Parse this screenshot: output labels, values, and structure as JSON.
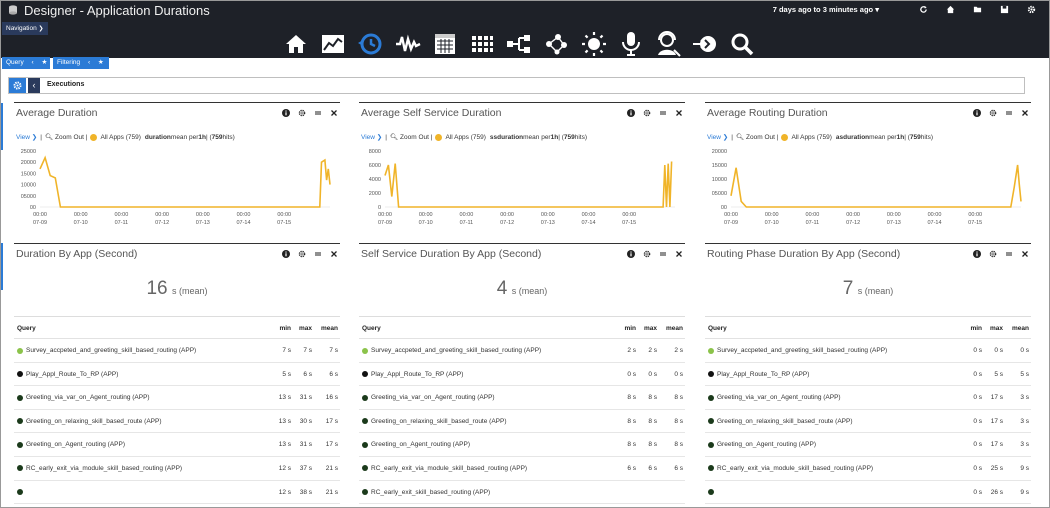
{
  "header": {
    "title": "Designer - Application Durations",
    "time_range": "7 days ago to 3 minutes ago",
    "nav_label": "Navigation",
    "tools": [
      "refresh-icon",
      "home-icon",
      "folder-icon",
      "save-icon",
      "settings-icon"
    ],
    "main_icons": [
      "home-icon",
      "line-chart-icon",
      "history-clock-icon",
      "waveform-icon",
      "calendar-grid-icon",
      "apps-grid-icon",
      "flow-diagram-icon",
      "network-icon",
      "sun-icon",
      "microphone-icon",
      "agent-icon",
      "exit-icon",
      "search-icon"
    ]
  },
  "filters": {
    "query_label": "Query",
    "filtering_label": "Filtering"
  },
  "executions": {
    "label": "Executions"
  },
  "colors": {
    "accent": "#2b7bd6",
    "series": "#f0b429",
    "topbar": "#1e2128"
  },
  "charts": [
    {
      "title": "Average Duration",
      "view_label": "View",
      "zoom_label": "Zoom Out |",
      "series_label": "All Apps (759)",
      "metric": "duration",
      "agg_text": " mean per ",
      "interval": "1h",
      "hits_prefix": " | (",
      "hits": "759",
      "hits_suffix": " hits)",
      "chart_data": {
        "type": "line",
        "series": [
          {
            "name": "All Apps (759)",
            "x": [
              "07-09 00:00",
              "07-09 03:00",
              "07-09 06:00",
              "07-09 09:00",
              "07-09 12:00",
              "07-15 21:00",
              "07-15 22:00",
              "07-16 00:00",
              "07-16 01:00",
              "07-16 02:00",
              "07-16 03:00"
            ],
            "values": [
              17000,
              22000,
              14000,
              13000,
              0,
              0,
              20000,
              21000,
              12000,
              17000,
              10000
            ]
          }
        ],
        "ylim": [
          0,
          25000
        ],
        "yticks": [
          "25000",
          "20000",
          "15000",
          "10000",
          "05000",
          "00"
        ],
        "xticks": [
          {
            "t": "00:00",
            "d": "07-09"
          },
          {
            "t": "00:00",
            "d": "07-10"
          },
          {
            "t": "00:00",
            "d": "07-11"
          },
          {
            "t": "00:00",
            "d": "07-12"
          },
          {
            "t": "00:00",
            "d": "07-13"
          },
          {
            "t": "00:00",
            "d": "07-14"
          },
          {
            "t": "00:00",
            "d": "07-15"
          }
        ],
        "xlabel": "",
        "ylabel": ""
      }
    },
    {
      "title": "Average Self Service Duration",
      "view_label": "View",
      "zoom_label": "Zoom Out |",
      "series_label": "All Apps (759)",
      "metric": "ssduration",
      "agg_text": " mean per ",
      "interval": "1h",
      "hits_prefix": " | (",
      "hits": "759",
      "hits_suffix": " hits)",
      "chart_data": {
        "type": "line",
        "series": [
          {
            "name": "All Apps (759)",
            "x": [
              "07-09 00:00",
              "07-09 02:00",
              "07-09 04:00",
              "07-09 06:00",
              "07-09 08:00",
              "07-15 20:00",
              "07-15 21:00",
              "07-15 22:00",
              "07-15 23:00",
              "07-16 00:00",
              "07-16 01:00"
            ],
            "values": [
              4500,
              6000,
              1500,
              6200,
              0,
              0,
              6000,
              0,
              6200,
              0,
              6500
            ]
          }
        ],
        "ylim": [
          0,
          8000
        ],
        "yticks": [
          "8000",
          "6000",
          "4000",
          "2000",
          "0"
        ],
        "xticks": [
          {
            "t": "00:00",
            "d": "07-09"
          },
          {
            "t": "00:00",
            "d": "07-10"
          },
          {
            "t": "00:00",
            "d": "07-11"
          },
          {
            "t": "00:00",
            "d": "07-12"
          },
          {
            "t": "00:00",
            "d": "07-13"
          },
          {
            "t": "00:00",
            "d": "07-14"
          },
          {
            "t": "00:00",
            "d": "07-15"
          }
        ],
        "xlabel": "",
        "ylabel": ""
      }
    },
    {
      "title": "Average Routing Duration",
      "view_label": "View",
      "zoom_label": "Zoom Out |",
      "series_label": "All Apps (759)",
      "metric": "asduration",
      "agg_text": " mean per ",
      "interval": "1h",
      "hits_prefix": " | (",
      "hits": "759",
      "hits_suffix": " hits)",
      "chart_data": {
        "type": "line",
        "series": [
          {
            "name": "All Apps (759)",
            "x": [
              "07-09 00:00",
              "07-09 03:00",
              "07-09 06:00",
              "07-09 09:00",
              "07-15 21:00",
              "07-15 23:00",
              "07-16 01:00",
              "07-16 02:00",
              "07-16 03:00"
            ],
            "values": [
              4000,
              14000,
              2000,
              0,
              0,
              7000,
              15000,
              8000,
              2000
            ]
          }
        ],
        "ylim": [
          0,
          20000
        ],
        "yticks": [
          "20000",
          "15000",
          "10000",
          "05000",
          "00"
        ],
        "xticks": [
          {
            "t": "00:00",
            "d": "07-09"
          },
          {
            "t": "00:00",
            "d": "07-10"
          },
          {
            "t": "00:00",
            "d": "07-11"
          },
          {
            "t": "00:00",
            "d": "07-12"
          },
          {
            "t": "00:00",
            "d": "07-13"
          },
          {
            "t": "00:00",
            "d": "07-14"
          },
          {
            "t": "00:00",
            "d": "07-15"
          }
        ],
        "xlabel": "",
        "ylabel": ""
      }
    }
  ],
  "tables": [
    {
      "title": "Duration By App (Second)",
      "metric_value": "16",
      "metric_unit": "s (mean)",
      "columns": [
        "Query",
        "min",
        "max",
        "mean"
      ],
      "rows": [
        {
          "q": "Survey_accpeted_and_greeting_skill_based_routing (APP)",
          "min": "7 s",
          "max": "7 s",
          "mean": "7 s",
          "color": "#8bc34a"
        },
        {
          "q": "Play_Appl_Route_To_RP (APP)",
          "min": "5 s",
          "max": "6 s",
          "mean": "6 s",
          "color": "#111111"
        },
        {
          "q": "Greeting_via_var_on_Agent_routing (APP)",
          "min": "13 s",
          "max": "31 s",
          "mean": "16 s",
          "color": "#1b3a1b"
        },
        {
          "q": "Greeting_on_relaxing_skill_based_route (APP)",
          "min": "13 s",
          "max": "30 s",
          "mean": "17 s",
          "color": "#1b3a1b"
        },
        {
          "q": "Greeting_on_Agent_routing (APP)",
          "min": "13 s",
          "max": "31 s",
          "mean": "17 s",
          "color": "#1b3a1b"
        },
        {
          "q": "RC_early_exit_via_module_skill_based_routing (APP)",
          "min": "12 s",
          "max": "37 s",
          "mean": "21 s",
          "color": "#1b3a1b"
        },
        {
          "q": "",
          "min": "12 s",
          "max": "38 s",
          "mean": "21 s",
          "color": "#1b3a1b"
        }
      ]
    },
    {
      "title": "Self Service Duration By App (Second)",
      "metric_value": "4",
      "metric_unit": "s (mean)",
      "columns": [
        "Query",
        "min",
        "max",
        "mean"
      ],
      "rows": [
        {
          "q": "Survey_accpeted_and_greeting_skill_based_routing (APP)",
          "min": "2 s",
          "max": "2 s",
          "mean": "2 s",
          "color": "#8bc34a"
        },
        {
          "q": "Play_Appl_Route_To_RP (APP)",
          "min": "0 s",
          "max": "0 s",
          "mean": "0 s",
          "color": "#111111"
        },
        {
          "q": "Greeting_via_var_on_Agent_routing (APP)",
          "min": "8 s",
          "max": "8 s",
          "mean": "8 s",
          "color": "#1b3a1b"
        },
        {
          "q": "Greeting_on_relaxing_skill_based_route (APP)",
          "min": "8 s",
          "max": "8 s",
          "mean": "8 s",
          "color": "#1b3a1b"
        },
        {
          "q": "Greeting_on_Agent_routing (APP)",
          "min": "8 s",
          "max": "8 s",
          "mean": "8 s",
          "color": "#1b3a1b"
        },
        {
          "q": "RC_early_exit_via_module_skill_based_routing (APP)",
          "min": "6 s",
          "max": "6 s",
          "mean": "6 s",
          "color": "#1b3a1b"
        },
        {
          "q": "RC_early_exit_skill_based_routing (APP)",
          "min": "",
          "max": "",
          "mean": "",
          "color": "#1b3a1b"
        }
      ]
    },
    {
      "title": "Routing Phase Duration By App (Second)",
      "metric_value": "7",
      "metric_unit": "s (mean)",
      "columns": [
        "Query",
        "min",
        "max",
        "mean"
      ],
      "rows": [
        {
          "q": "Survey_accpeted_and_greeting_skill_based_routing (APP)",
          "min": "0 s",
          "max": "0 s",
          "mean": "0 s",
          "color": "#8bc34a"
        },
        {
          "q": "Play_Appl_Route_To_RP (APP)",
          "min": "0 s",
          "max": "5 s",
          "mean": "5 s",
          "color": "#111111"
        },
        {
          "q": "Greeting_via_var_on_Agent_routing (APP)",
          "min": "0 s",
          "max": "17 s",
          "mean": "3 s",
          "color": "#1b3a1b"
        },
        {
          "q": "Greeting_on_relaxing_skill_based_route (APP)",
          "min": "0 s",
          "max": "17 s",
          "mean": "3 s",
          "color": "#1b3a1b"
        },
        {
          "q": "Greeting_on_Agent_routing (APP)",
          "min": "0 s",
          "max": "17 s",
          "mean": "3 s",
          "color": "#1b3a1b"
        },
        {
          "q": "RC_early_exit_via_module_skill_based_routing (APP)",
          "min": "0 s",
          "max": "25 s",
          "mean": "9 s",
          "color": "#1b3a1b"
        },
        {
          "q": "",
          "min": "0 s",
          "max": "26 s",
          "mean": "9 s",
          "color": "#1b3a1b"
        }
      ]
    }
  ]
}
